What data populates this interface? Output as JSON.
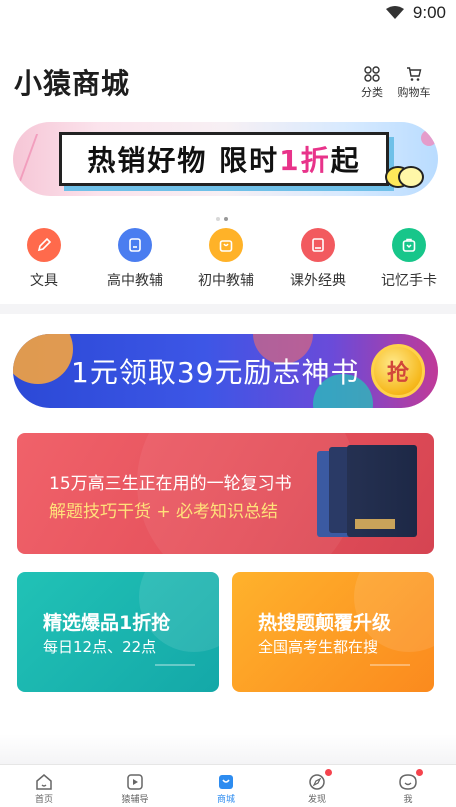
{
  "status_bar": {
    "time": "9:00",
    "wifi_icon": "wifi-icon"
  },
  "header": {
    "title": "小猿商城",
    "category_label": "分类",
    "cart_label": "购物车"
  },
  "top_banner": {
    "text_main": "热销好物  限时",
    "text_highlight": "1折",
    "text_end": "起",
    "page_count": 2,
    "current_page": 2
  },
  "categories": [
    {
      "label": "文具",
      "icon": "pencil-icon",
      "color": "#ff6a4c"
    },
    {
      "label": "高中教辅",
      "icon": "book-face-icon",
      "color": "#4a7df0"
    },
    {
      "label": "初中教辅",
      "icon": "shopping-bag-icon",
      "color": "#ffb228"
    },
    {
      "label": "课外经典",
      "icon": "book-icon",
      "color": "#f25a5f"
    },
    {
      "label": "记忆手卡",
      "icon": "card-bag-icon",
      "color": "#17c68a"
    }
  ],
  "promo_banner": {
    "text": "1元领取39元励志神书",
    "button": "抢"
  },
  "review_card": {
    "line1": "15万高三生正在用的一轮复习书",
    "line2": "解题技巧干货 + 必考知识总结"
  },
  "small_cards": [
    {
      "title": "精选爆品1折抢",
      "subtitle": "每日12点、22点"
    },
    {
      "title": "热搜题颠覆升级",
      "subtitle": "全国高考生都在搜"
    }
  ],
  "tabbar": [
    {
      "label": "首页",
      "icon": "home-icon",
      "active": false,
      "badge": false
    },
    {
      "label": "猿辅导",
      "icon": "video-play-icon",
      "active": false,
      "badge": false
    },
    {
      "label": "商城",
      "icon": "shop-bag-icon",
      "active": true,
      "badge": false
    },
    {
      "label": "发现",
      "icon": "compass-icon",
      "active": false,
      "badge": true
    },
    {
      "label": "我",
      "icon": "face-icon",
      "active": false,
      "badge": true
    }
  ],
  "colors": {
    "accent": "#2d8cf0",
    "badge": "#f5434d"
  }
}
